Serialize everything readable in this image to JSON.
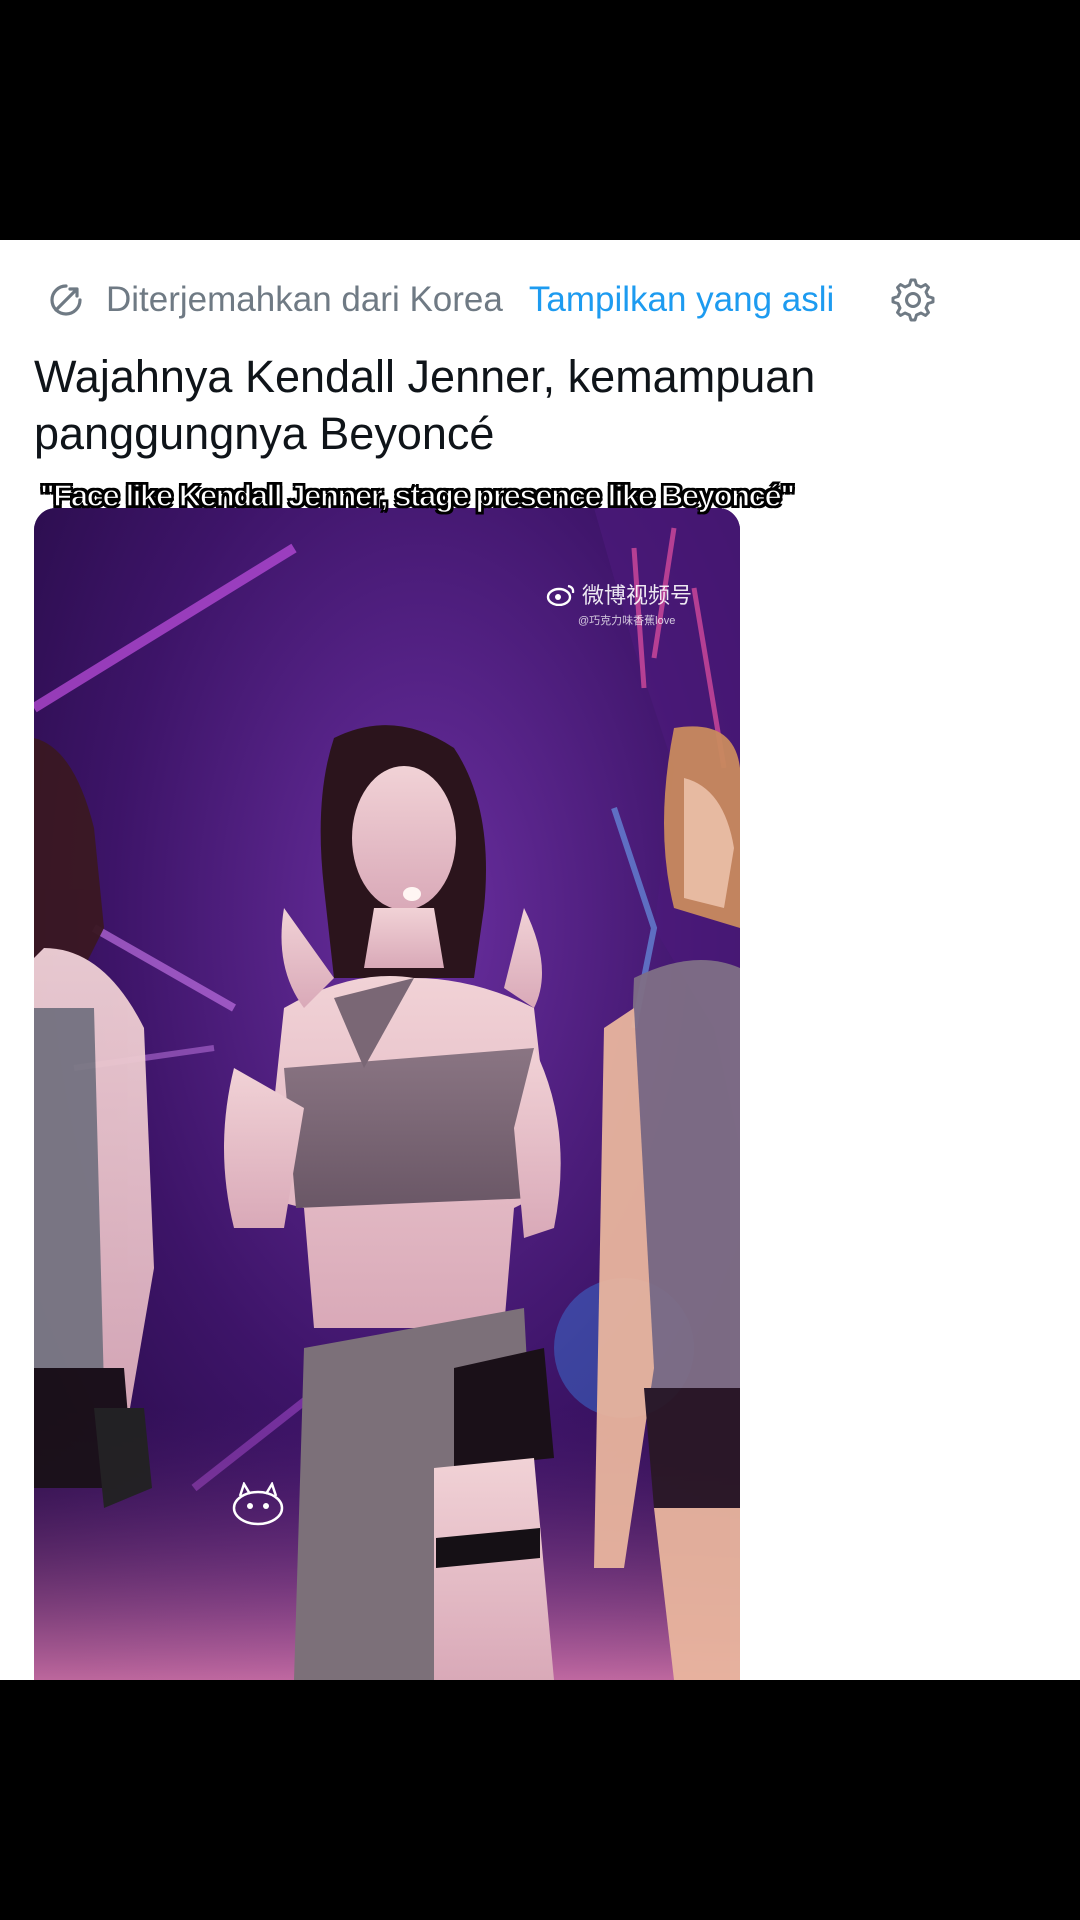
{
  "translation_bar": {
    "label": "Diterjemahkan dari Korea",
    "show_original_label": "Tampilkan yang asli",
    "translate_icon": "translate-icon",
    "settings_icon": "gear-icon",
    "link_color": "#1d9bf0"
  },
  "tweet": {
    "text": "Wajahnya Kendall Jenner, kemampuan panggungnya Beyoncé"
  },
  "media": {
    "caption": "\"Face like Kendall Jenner, stage presence like Beyoncé\"",
    "watermark_main": "微博视频号",
    "watermark_sub": "@巧克力味香蕉love"
  }
}
